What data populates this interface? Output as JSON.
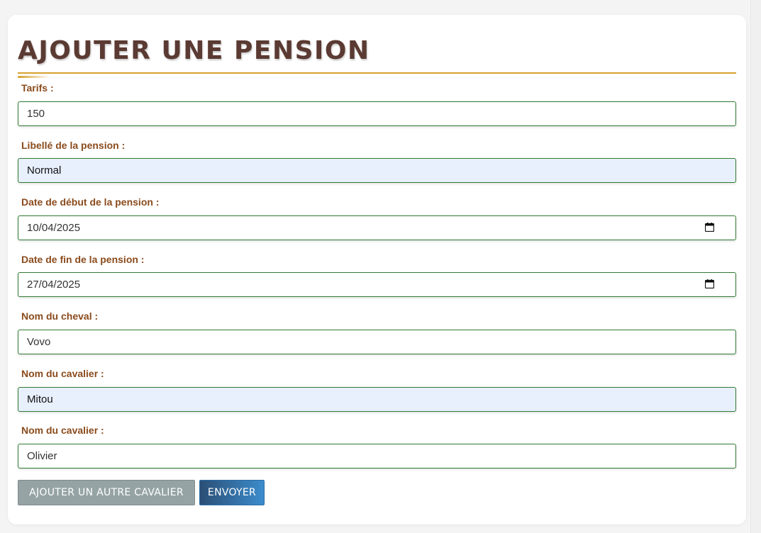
{
  "form": {
    "title": "AJOUTER UNE PENSION",
    "fields": [
      {
        "label": "Tarifs :",
        "value": "150",
        "autofilled": false,
        "type": "number"
      },
      {
        "label": "Libellé de la pension :",
        "value": "Normal",
        "autofilled": true,
        "type": "text"
      },
      {
        "label": "Date de début de la pension :",
        "value": "10/04/2025",
        "autofilled": false,
        "type": "date",
        "icon": "calendar-icon"
      },
      {
        "label": "Date de fin de la pension :",
        "value": "27/04/2025",
        "autofilled": false,
        "type": "date",
        "icon": "calendar-icon"
      },
      {
        "label": "Nom du cheval :",
        "value": "Vovo",
        "autofilled": false,
        "type": "text"
      },
      {
        "label": "Nom du cavalier :",
        "value": "Mitou",
        "autofilled": true,
        "type": "text"
      },
      {
        "label": "Nom du cavalier :",
        "value": "Olivier",
        "autofilled": false,
        "type": "text"
      }
    ],
    "buttons": {
      "add_rider": "AJOUTER UN AUTRE CAVALIER",
      "submit": "ENVOYER"
    }
  },
  "colors": {
    "title": "#5a3a32",
    "accent_underline": "#d7a12e",
    "label": "#8a4b1c",
    "field_border": "#2f7a32",
    "autofill_background": "#e8f0fe",
    "add_button": "#95a3a4",
    "submit_button": "#2f6fa8"
  }
}
